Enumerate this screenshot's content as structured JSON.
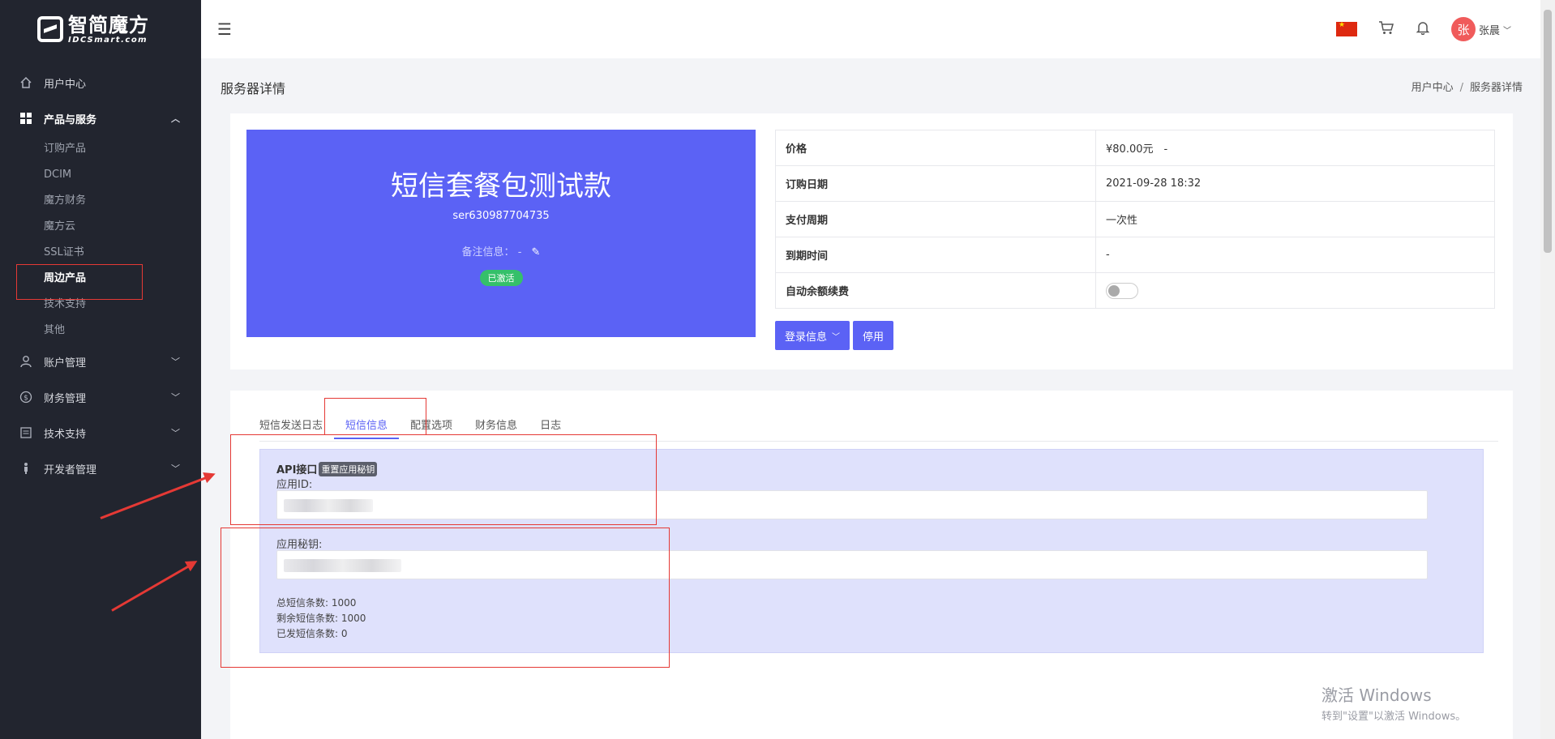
{
  "brand": {
    "name_cn": "智简魔方",
    "name_en": "IDCSmart.com"
  },
  "sidebar": {
    "items": [
      {
        "label": "用户中心",
        "icon": "home-icon"
      },
      {
        "label": "产品与服务",
        "icon": "grid-icon",
        "expanded": true,
        "children": [
          "订购产品",
          "DCIM",
          "魔方财务",
          "魔方云",
          "SSL证书",
          "周边产品",
          "技术支持",
          "其他"
        ],
        "active_child": "周边产品"
      },
      {
        "label": "账户管理",
        "icon": "user-icon"
      },
      {
        "label": "财务管理",
        "icon": "dollar-icon"
      },
      {
        "label": "技术支持",
        "icon": "document-icon"
      },
      {
        "label": "开发者管理",
        "icon": "developer-icon"
      }
    ]
  },
  "header": {
    "user_name": "张晨",
    "avatar_text": "张"
  },
  "page": {
    "title": "服务器详情",
    "breadcrumb": [
      "用户中心",
      "服务器详情"
    ]
  },
  "product": {
    "name": "短信套餐包测试款",
    "serial": "ser630987704735",
    "remark_label": "备注信息：",
    "remark_value": "-",
    "status": "已激活"
  },
  "info": [
    {
      "key": "价格",
      "value": "¥80.00元　-"
    },
    {
      "key": "订购日期",
      "value": "2021-09-28 18:32"
    },
    {
      "key": "支付周期",
      "value": "一次性"
    },
    {
      "key": "到期时间",
      "value": "-"
    },
    {
      "key": "自动余额续费",
      "value": "",
      "toggle_on": false
    }
  ],
  "actions": {
    "login_info": "登录信息",
    "disable": "停用"
  },
  "tabs": [
    "短信发送日志",
    "短信信息",
    "配置选项",
    "财务信息",
    "日志"
  ],
  "active_tab": "短信信息",
  "api": {
    "title": "API接口",
    "reset_label": "重置应用秘钥",
    "app_id_label": "应用ID:",
    "app_secret_label": "应用秘钥:",
    "total_label": "总短信条数:",
    "total": "1000",
    "remaining_label": "剩余短信条数:",
    "remaining": "1000",
    "sent_label": "已发短信条数:",
    "sent": "0"
  },
  "watermark": {
    "line1": "激活 Windows",
    "line2": "转到\"设置\"以激活 Windows。"
  },
  "colors": {
    "sidebar": "#22252f",
    "accent": "#5b62f5",
    "success": "#35c06a",
    "annotation": "#e53935"
  }
}
